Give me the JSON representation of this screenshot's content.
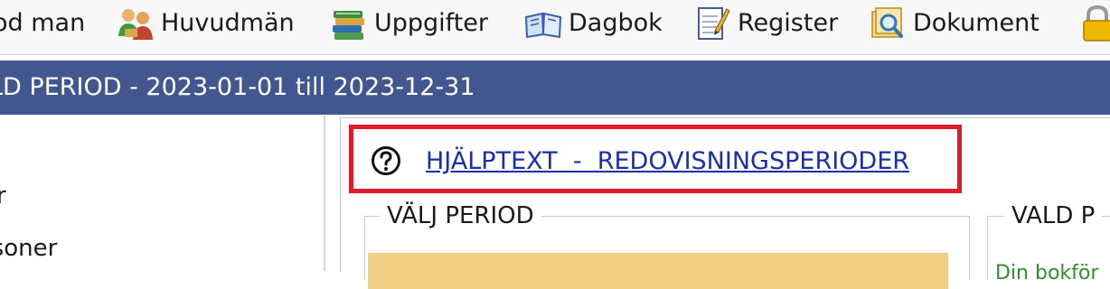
{
  "toolbar": {
    "items": [
      {
        "label": "od man",
        "icon": "person-icon"
      },
      {
        "label": "Huvudmän",
        "icon": "people-icon"
      },
      {
        "label": "Uppgifter",
        "icon": "books-icon"
      },
      {
        "label": "Dagbok",
        "icon": "open-book-icon"
      },
      {
        "label": "Register",
        "icon": "notepad-icon"
      },
      {
        "label": "Dokument",
        "icon": "document-search-icon"
      },
      {
        "label": "",
        "icon": "lock-icon"
      }
    ]
  },
  "header": {
    "title": "LD PERIOD - 2023-01-01 till 2023-12-31"
  },
  "left_nav": {
    "items": [
      "er",
      "rsoner"
    ]
  },
  "help": {
    "link_text": "HJÄLPTEXT  -  REDOVISNINGSPERIODER",
    "icon": "help-circle-icon"
  },
  "choose_period": {
    "legend": "VÄLJ PERIOD"
  },
  "selected_period": {
    "legend": "VALD P",
    "text": "Din bokför"
  },
  "colors": {
    "header_bg": "#42578f",
    "help_border": "#dd1d2c",
    "link": "#1b2fa6",
    "period_highlight": "#f2cd84",
    "info_text": "#2f8f2f"
  }
}
